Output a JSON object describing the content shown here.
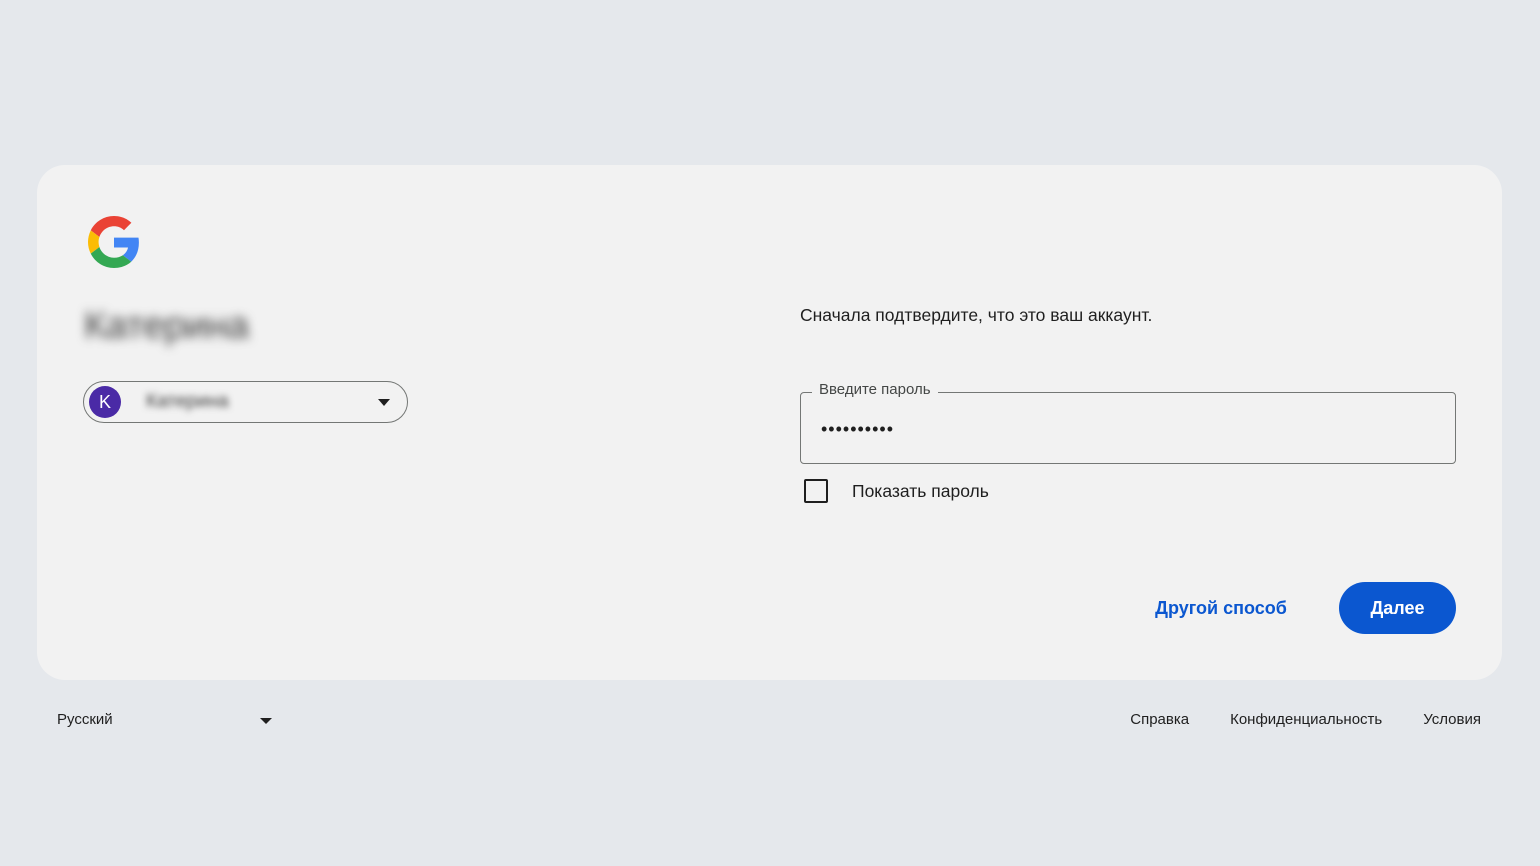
{
  "account": {
    "name": "Катерина",
    "chip_initial": "K",
    "chip_email": "Катерина",
    "avatar_color": "#4a2aa6"
  },
  "main": {
    "prompt": "Сначала подтвердите, что это ваш аккаунт.",
    "password_label": "Введите пароль",
    "password_value": "••••••••••",
    "show_password_label": "Показать пароль",
    "show_password_checked": false,
    "other_way_label": "Другой способ",
    "next_label": "Далее"
  },
  "footer": {
    "language": "Русский",
    "links": [
      "Справка",
      "Конфиденциальность",
      "Условия"
    ]
  },
  "colors": {
    "page_bg": "#e5e8ec",
    "card_bg": "#f2f2f2",
    "primary": "#0b57d0",
    "google_blue": "#4285F4",
    "google_red": "#EA4335",
    "google_yellow": "#FBBC05",
    "google_green": "#34A853"
  },
  "icons": [
    "google-logo-icon",
    "chevron-down-icon",
    "checkbox-icon"
  ]
}
